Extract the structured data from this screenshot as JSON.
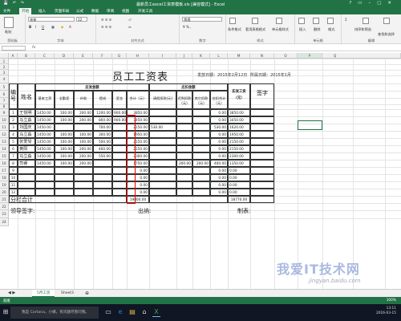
{
  "window": {
    "title": "最新员工excel工资表模板.xls [兼容模式] - Excel",
    "controls": [
      "?",
      "▭",
      "–",
      "▢",
      "✕"
    ]
  },
  "ribbon_tabs": [
    "文件",
    "开始",
    "插入",
    "页面布局",
    "公式",
    "数据",
    "审阅",
    "视图",
    "开发工具"
  ],
  "ribbon": {
    "font_name": "宋体",
    "font_size": "12",
    "number_format": "常规",
    "groups": [
      "剪贴板",
      "字体",
      "对齐方式",
      "数字",
      "样式",
      "单元格",
      "编辑"
    ],
    "buttons": [
      "粘贴",
      "条件格式",
      "套用表格格式",
      "单元格样式",
      "插入",
      "删除",
      "格式",
      "排序和筛选",
      "查找和选择"
    ]
  },
  "formula_bar": {
    "name_box": "",
    "fx": "fx"
  },
  "columns": [
    "A",
    "B",
    "C",
    "D",
    "E",
    "F",
    "G",
    "H",
    "I",
    "J",
    "K",
    "L",
    "M",
    "N",
    "O",
    "P",
    "Q"
  ],
  "rows": [
    "1",
    "2",
    "3",
    "4",
    "5",
    "6",
    "7",
    "8",
    "9",
    "10",
    "11",
    "12",
    "13",
    "14",
    "15",
    "16",
    "17",
    "18",
    "19",
    "20",
    "21",
    "22",
    "23",
    "24"
  ],
  "sheet": {
    "title": "员工工资表",
    "issue_date": "发放日期：2015年2月12日",
    "period": "所属日期：2015年1月",
    "h_no": "编号",
    "h_name": "姓名",
    "h_payable": "应发金额",
    "h_deduct": "应扣金额",
    "h_actual": "实发工资（元）",
    "h_sign": "签字",
    "sub_headers": [
      "基本工资",
      "全勤奖",
      "补助",
      "提成",
      "奖金",
      "合计（元）",
      "请假扣款(元)",
      "迟到扣款(元)",
      "其它扣款(元)",
      "应扣合计（元）"
    ],
    "employees": [
      {
        "no": "1",
        "name": "王悦明",
        "c1": "1450.00",
        "c2": "100.00",
        "c3": "200.00",
        "c4": "1200.00",
        "c5": "900.00",
        "total": "3850.00",
        "d1": "",
        "d2": "",
        "d3": "",
        "dtotal": "0.00",
        "actual": "3850.00"
      },
      {
        "no": "2",
        "name": "马立淼",
        "c1": "1450.00",
        "c2": "100.00",
        "c3": "200.00",
        "c4": "800.00",
        "c5": "900.00",
        "total": "3450.00",
        "d1": "",
        "d2": "",
        "d3": "",
        "dtotal": "0.00",
        "actual": "3450.00"
      },
      {
        "no": "3",
        "name": "刘国庆",
        "c1": "1450.00",
        "c2": "",
        "c3": "",
        "c4": "700.00",
        "c5": "",
        "total": "2150.00",
        "d1": "530.00",
        "d2": "",
        "d3": "",
        "dtotal": "530.00",
        "actual": "1620.00"
      },
      {
        "no": "4",
        "name": "马立淼",
        "c1": "1450.00",
        "c2": "100.00",
        "c3": "100.00",
        "c4": "300.00",
        "c5": "",
        "total": "1950.00",
        "d1": "",
        "d2": "",
        "d3": "",
        "dtotal": "0.00",
        "actual": "1950.00"
      },
      {
        "no": "5",
        "name": "张爱琴",
        "c1": "1450.00",
        "c2": "100.00",
        "c3": "100.00",
        "c4": "500.00",
        "c5": "",
        "total": "2150.00",
        "d1": "",
        "d2": "",
        "d3": "",
        "dtotal": "0.00",
        "actual": "2150.00"
      },
      {
        "no": "6",
        "name": "黄阳",
        "c1": "1450.00",
        "c2": "100.00",
        "c3": "200.00",
        "c4": "400.00",
        "c5": "",
        "total": "2150.00",
        "d1": "",
        "d2": "",
        "d3": "",
        "dtotal": "0.00",
        "actual": "2150.00"
      },
      {
        "no": "7",
        "name": "马立淼",
        "c1": "1450.00",
        "c2": "100.00",
        "c3": "200.00",
        "c4": "550.00",
        "c5": "",
        "total": "2300.00",
        "d1": "",
        "d2": "",
        "d3": "",
        "dtotal": "0.00",
        "actual": "2300.00"
      },
      {
        "no": "8",
        "name": "司睿",
        "c1": "1450.00",
        "c2": "100.00",
        "c3": "200.00",
        "c4": "",
        "c5": "",
        "total": "1750.00",
        "d1": "",
        "d2": "200.00",
        "d3": "200.00",
        "dtotal": "400.00",
        "actual": "1350.00"
      },
      {
        "no": "9",
        "name": "",
        "c1": "",
        "c2": "",
        "c3": "",
        "c4": "",
        "c5": "",
        "total": "0.00",
        "d1": "",
        "d2": "",
        "d3": "",
        "dtotal": "0.00",
        "actual": "0.00"
      },
      {
        "no": "10",
        "name": "",
        "c1": "",
        "c2": "",
        "c3": "",
        "c4": "",
        "c5": "",
        "total": "0.00",
        "d1": "",
        "d2": "",
        "d3": "",
        "dtotal": "0.00",
        "actual": "0.00"
      },
      {
        "no": "11",
        "name": "",
        "c1": "",
        "c2": "",
        "c3": "",
        "c4": "",
        "c5": "",
        "total": "0.00",
        "d1": "",
        "d2": "",
        "d3": "",
        "dtotal": "0.00",
        "actual": "0.00"
      },
      {
        "no": "12",
        "name": "",
        "c1": "",
        "c2": "",
        "c3": "",
        "c4": "",
        "c5": "",
        "total": "0.00",
        "d1": "",
        "d2": "",
        "d3": "",
        "dtotal": "0.00",
        "actual": "0.00"
      }
    ],
    "subtotal_label": "分栏合计",
    "subtotal_total": "19800.00",
    "subtotal_actual": "18770.00",
    "sign_leader": "领导签字:",
    "sign_cashier": "出纳:",
    "sign_maker": "制表:"
  },
  "sheet_tabs": [
    "5月工资",
    "Sheet3"
  ],
  "status": {
    "left": "就绪",
    "zoom": "100%"
  },
  "taskbar": {
    "search": "我是 Cortana，小娜。有问题尽管问我。",
    "time": "13:11",
    "date": "2016-03-15"
  },
  "watermark": {
    "line1": "我爱IT技术网",
    "line2": "jingyan.baidu.com"
  },
  "colors": {
    "excel_green": "#217346",
    "highlight_red": "#e00000",
    "taskbar": "#101623"
  }
}
